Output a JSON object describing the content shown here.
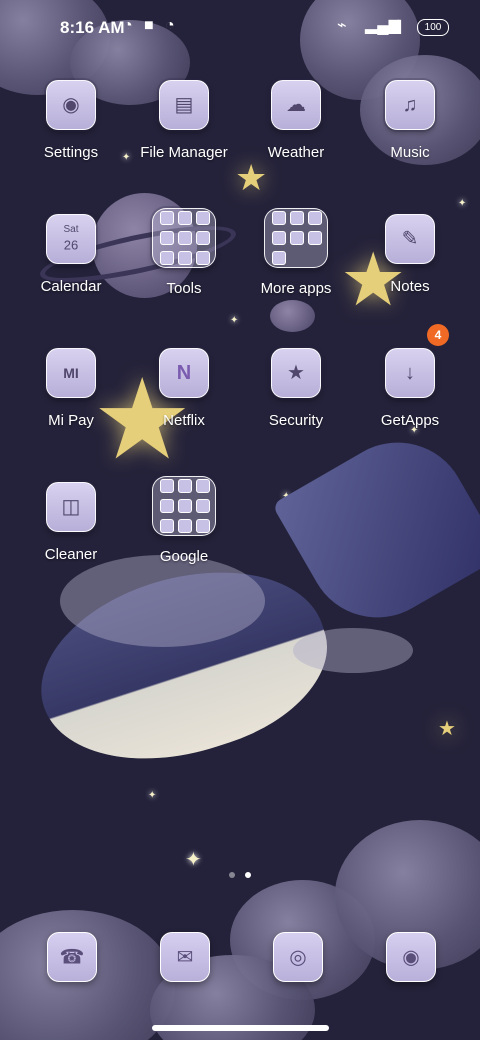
{
  "status_bar": {
    "time": "8:16 AM",
    "battery": "100",
    "icons": [
      "app-notification-icon",
      "square-icon",
      "app-notification-icon",
      "silent-icon",
      "signal-icon",
      "wifi-icon"
    ]
  },
  "apps": [
    {
      "name": "Settings",
      "icon": "◉"
    },
    {
      "name": "File Manager",
      "icon": "▤"
    },
    {
      "name": "Weather",
      "icon": "☁"
    },
    {
      "name": "Music",
      "icon": "♫"
    },
    {
      "name": "Calendar",
      "icon": "26"
    },
    {
      "name": "Tools",
      "icon": "folder"
    },
    {
      "name": "More apps",
      "icon": "folder"
    },
    {
      "name": "Notes",
      "icon": "✎"
    },
    {
      "name": "Mi Pay",
      "icon": "MI"
    },
    {
      "name": "Netflix",
      "icon": "N"
    },
    {
      "name": "Security",
      "icon": "★"
    },
    {
      "name": "GetApps",
      "icon": "↓",
      "badge": "4"
    },
    {
      "name": "Cleaner",
      "icon": "◫"
    },
    {
      "name": "Google",
      "icon": "folder"
    }
  ],
  "calendar_widget": {
    "day": "Sat",
    "date": "26"
  },
  "dock": [
    {
      "name": "phone",
      "icon": "☎"
    },
    {
      "name": "messages",
      "icon": "✉"
    },
    {
      "name": "browser",
      "icon": "◎"
    },
    {
      "name": "camera",
      "icon": "◉"
    }
  ],
  "page_indicator": {
    "current": 2,
    "total": 2
  },
  "colors": {
    "badge": "#f06a25",
    "background": "#24223a"
  }
}
